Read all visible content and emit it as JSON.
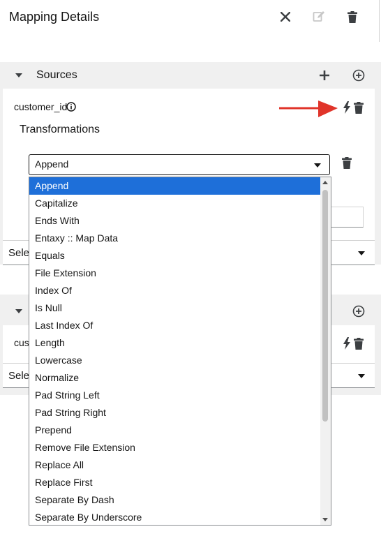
{
  "header": {
    "title": "Mapping Details"
  },
  "icons": {
    "close": "close-icon",
    "edit": "edit-icon",
    "delete": "trash-icon"
  },
  "sources_panel": {
    "label": "Sources"
  },
  "source_field": {
    "name": "customer_id"
  },
  "transformations": {
    "label": "Transformations",
    "selected": "Append",
    "options": [
      "Append",
      "Capitalize",
      "Ends With",
      "Entaxy :: Map Data",
      "Equals",
      "File Extension",
      "Index Of",
      "Is Null",
      "Last Index Of",
      "Length",
      "Lowercase",
      "Normalize",
      "Pad String Left",
      "Pad String Right",
      "Prepend",
      "Remove File Extension",
      "Replace All",
      "Replace First",
      "Separate By Dash",
      "Separate By Underscore"
    ]
  },
  "select_partial_1": "Sele",
  "target_field_partial": "cust",
  "select_partial_2": "Sele",
  "colors": {
    "accent": "#1e6fd9",
    "annotation_arrow": "#e0342a"
  }
}
